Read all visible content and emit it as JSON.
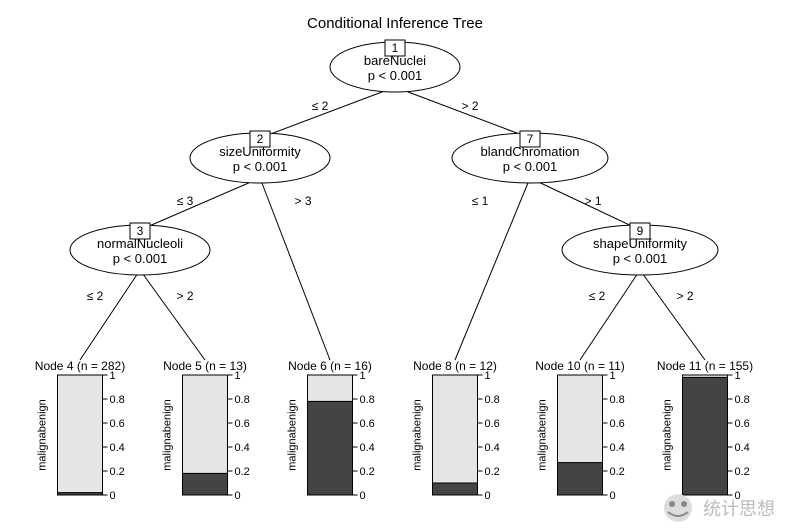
{
  "title": "Conditional Inference Tree",
  "ylabel": "malignabenign",
  "ticks": [
    "0",
    "0.2",
    "0.4",
    "0.6",
    "0.8",
    "1"
  ],
  "nodes": {
    "1": {
      "num": "1",
      "var": "bareNuclei",
      "p": "p < 0.001",
      "left": "≤ 2",
      "right": "> 2"
    },
    "2": {
      "num": "2",
      "var": "sizeUniformity",
      "p": "p < 0.001",
      "left": "≤ 3",
      "right": "> 3"
    },
    "3": {
      "num": "3",
      "var": "normalNucleoli",
      "p": "p < 0.001",
      "left": "≤ 2",
      "right": "> 2"
    },
    "7": {
      "num": "7",
      "var": "blandChromation",
      "p": "p < 0.001",
      "left": "≤ 1",
      "right": "> 1"
    },
    "9": {
      "num": "9",
      "var": "shapeUniformity",
      "p": "p < 0.001",
      "left": "≤ 2",
      "right": "> 2"
    }
  },
  "leaves": [
    {
      "title": "Node 4 (n = 282)",
      "malignant": 0.02
    },
    {
      "title": "Node 5 (n = 13)",
      "malignant": 0.18
    },
    {
      "title": "Node 6 (n = 16)",
      "malignant": 0.78
    },
    {
      "title": "Node 8 (n = 12)",
      "malignant": 0.1
    },
    {
      "title": "Node 10 (n = 11)",
      "malignant": 0.27
    },
    {
      "title": "Node 11 (n = 155)",
      "malignant": 0.98
    }
  ],
  "chart_data": {
    "type": "tree",
    "title": "Conditional Inference Tree",
    "inner_nodes": [
      {
        "id": 1,
        "variable": "bareNuclei",
        "p_value": "< 0.001",
        "split": 2,
        "left_child": 2,
        "right_child": 7
      },
      {
        "id": 2,
        "variable": "sizeUniformity",
        "p_value": "< 0.001",
        "split": 3,
        "left_child": 3,
        "right_child": 6
      },
      {
        "id": 3,
        "variable": "normalNucleoli",
        "p_value": "< 0.001",
        "split": 2,
        "left_child": 4,
        "right_child": 5
      },
      {
        "id": 7,
        "variable": "blandChromation",
        "p_value": "< 0.001",
        "split": 1,
        "left_child": 8,
        "right_child": 9
      },
      {
        "id": 9,
        "variable": "shapeUniformity",
        "p_value": "< 0.001",
        "split": 2,
        "left_child": 10,
        "right_child": 11
      }
    ],
    "terminal_nodes": [
      {
        "id": 4,
        "n": 282,
        "malignant": 0.02,
        "benign": 0.98
      },
      {
        "id": 5,
        "n": 13,
        "malignant": 0.18,
        "benign": 0.82
      },
      {
        "id": 6,
        "n": 16,
        "malignant": 0.78,
        "benign": 0.22
      },
      {
        "id": 8,
        "n": 12,
        "malignant": 0.1,
        "benign": 0.9
      },
      {
        "id": 10,
        "n": 11,
        "malignant": 0.27,
        "benign": 0.73
      },
      {
        "id": 11,
        "n": 155,
        "malignant": 0.98,
        "benign": 0.02
      }
    ],
    "ylabel": "malignant / benign",
    "ylim": [
      0,
      1
    ]
  },
  "watermark": "统计思想",
  "wechat": "wechat-logo"
}
